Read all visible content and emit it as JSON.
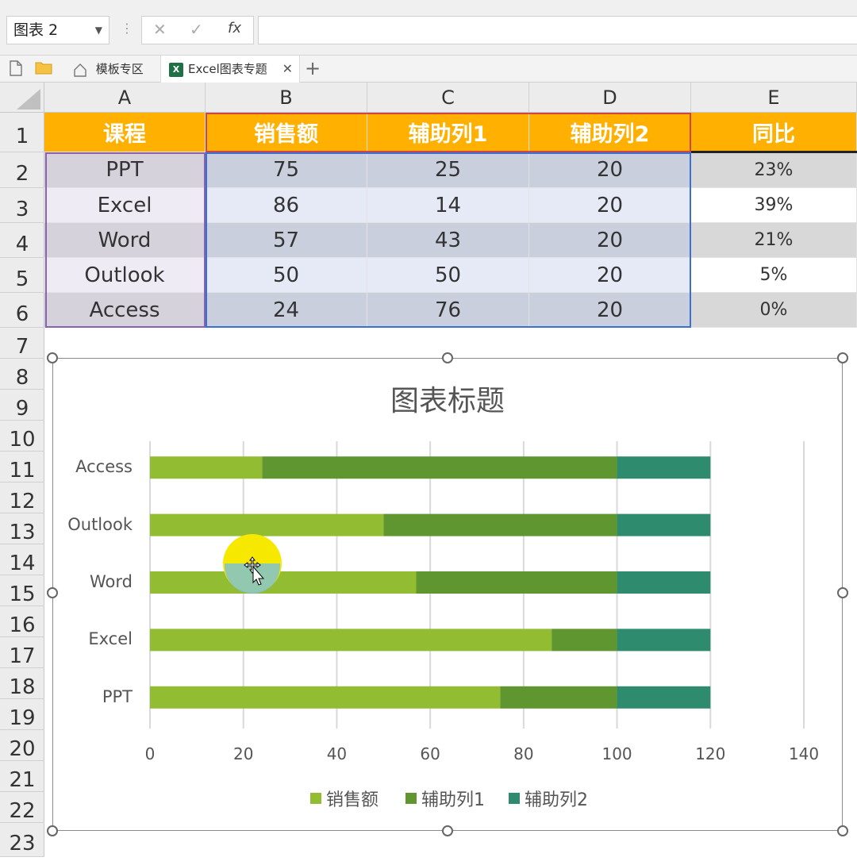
{
  "formula_bar": {
    "name_box": "图表 2",
    "cancel_icon": "✕",
    "confirm_icon": "✓",
    "fx_label": "fx",
    "formula": ""
  },
  "tabs": [
    {
      "label": "模板专区"
    },
    {
      "label": "Excel图表专题"
    }
  ],
  "add_tab": "+",
  "columns": [
    "A",
    "B",
    "C",
    "D",
    "E"
  ],
  "rows": [
    "1",
    "2",
    "3",
    "4",
    "5",
    "6",
    "7",
    "8",
    "9",
    "10",
    "11",
    "12",
    "13",
    "14",
    "15",
    "16",
    "17",
    "18",
    "19",
    "20",
    "21",
    "22",
    "23"
  ],
  "table": {
    "header": [
      "课程",
      "销售额",
      "辅助列1",
      "辅助列2",
      "同比"
    ],
    "rows": [
      [
        "PPT",
        "75",
        "25",
        "20",
        "23%"
      ],
      [
        "Excel",
        "86",
        "14",
        "20",
        "39%"
      ],
      [
        "Word",
        "57",
        "43",
        "20",
        "21%"
      ],
      [
        "Outlook",
        "50",
        "50",
        "20",
        "5%"
      ],
      [
        "Access",
        "24",
        "76",
        "20",
        "0%"
      ]
    ]
  },
  "colors": {
    "header_fill": "#ffb000",
    "series1": "#92bc32",
    "series2": "#5f9630",
    "series3": "#2e8b6e"
  },
  "chart_data": {
    "type": "bar",
    "orientation": "horizontal",
    "stacked": true,
    "title": "图表标题",
    "categories": [
      "PPT",
      "Excel",
      "Word",
      "Outlook",
      "Access"
    ],
    "series": [
      {
        "name": "销售额",
        "values": [
          75,
          86,
          57,
          50,
          24
        ]
      },
      {
        "name": "辅助列1",
        "values": [
          25,
          14,
          43,
          50,
          76
        ]
      },
      {
        "name": "辅助列2",
        "values": [
          20,
          20,
          20,
          20,
          20
        ]
      }
    ],
    "xlim": [
      0,
      140
    ],
    "xticks": [
      "0",
      "20",
      "40",
      "60",
      "80",
      "100",
      "120",
      "140"
    ],
    "grid": true,
    "legend": "bottom"
  }
}
